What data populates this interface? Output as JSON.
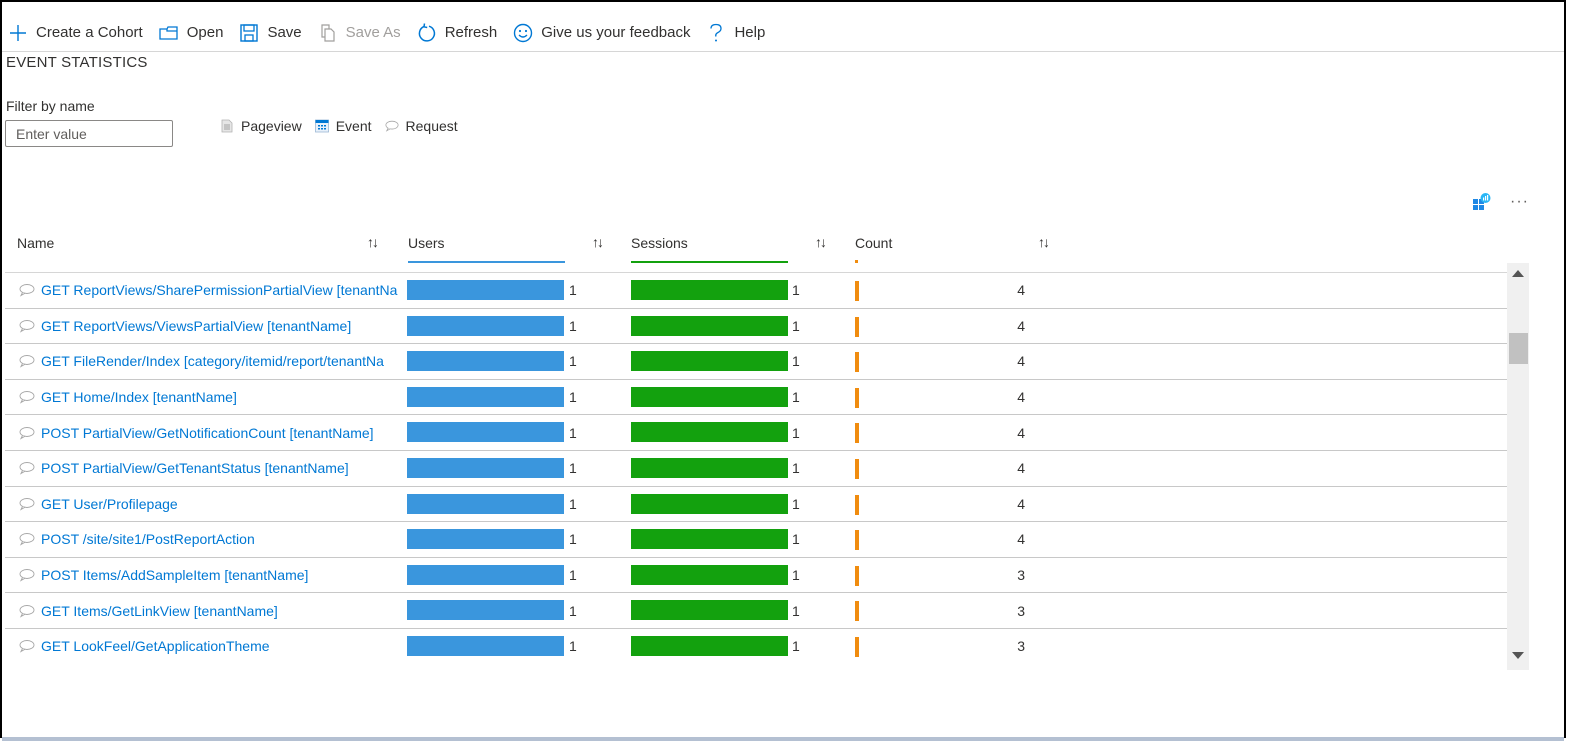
{
  "toolbar": {
    "items": [
      {
        "label": "Create a Cohort",
        "icon": "plus-icon",
        "disabled": false
      },
      {
        "label": "Open",
        "icon": "folder-open-icon",
        "disabled": false
      },
      {
        "label": "Save",
        "icon": "save-icon",
        "disabled": false
      },
      {
        "label": "Save As",
        "icon": "copy-icon",
        "disabled": true
      },
      {
        "label": "Refresh",
        "icon": "refresh-icon",
        "disabled": false
      },
      {
        "label": "Give us your feedback",
        "icon": "smiley-icon",
        "disabled": false
      },
      {
        "label": "Help",
        "icon": "question-icon",
        "disabled": false
      }
    ]
  },
  "section": {
    "title": "EVENT STATISTICS"
  },
  "filter": {
    "label": "Filter by name",
    "placeholder": "Enter value",
    "value": ""
  },
  "legend": [
    {
      "label": "Pageview",
      "icon": "pageview-icon"
    },
    {
      "label": "Event",
      "icon": "event-icon"
    },
    {
      "label": "Request",
      "icon": "request-icon"
    }
  ],
  "actions": {
    "more": "···"
  },
  "colors": {
    "users_bar": "#3a96dd",
    "sessions_bar": "#13a10e",
    "count_mark": "#f08c0f",
    "link": "#0078d4"
  },
  "table": {
    "columns": [
      {
        "label": "Name",
        "sort": "↑↓"
      },
      {
        "label": "Users",
        "sort": "↑↓"
      },
      {
        "label": "Sessions",
        "sort": "↑↓"
      },
      {
        "label": "Count",
        "sort": "↑↓"
      }
    ],
    "rows": [
      {
        "name": "GET ReportViews/SharePermissionPartialView [tenantNa",
        "users": "1",
        "sessions": "1",
        "count": "4",
        "users_frac": 1,
        "sessions_frac": 1
      },
      {
        "name": "GET ReportViews/ViewsPartialView [tenantName]",
        "users": "1",
        "sessions": "1",
        "count": "4",
        "users_frac": 1,
        "sessions_frac": 1
      },
      {
        "name": "GET FileRender/Index [category/itemid/report/tenantNa",
        "users": "1",
        "sessions": "1",
        "count": "4",
        "users_frac": 1,
        "sessions_frac": 1
      },
      {
        "name": "GET Home/Index [tenantName]",
        "users": "1",
        "sessions": "1",
        "count": "4",
        "users_frac": 1,
        "sessions_frac": 1
      },
      {
        "name": "POST PartialView/GetNotificationCount [tenantName]",
        "users": "1",
        "sessions": "1",
        "count": "4",
        "users_frac": 1,
        "sessions_frac": 1
      },
      {
        "name": "POST PartialView/GetTenantStatus [tenantName]",
        "users": "1",
        "sessions": "1",
        "count": "4",
        "users_frac": 1,
        "sessions_frac": 1
      },
      {
        "name": "GET User/Profilepage",
        "users": "1",
        "sessions": "1",
        "count": "4",
        "users_frac": 1,
        "sessions_frac": 1
      },
      {
        "name": "POST /site/site1/PostReportAction",
        "users": "1",
        "sessions": "1",
        "count": "4",
        "users_frac": 1,
        "sessions_frac": 1
      },
      {
        "name": "POST Items/AddSampleItem [tenantName]",
        "users": "1",
        "sessions": "1",
        "count": "3",
        "users_frac": 1,
        "sessions_frac": 1
      },
      {
        "name": "GET Items/GetLinkView [tenantName]",
        "users": "1",
        "sessions": "1",
        "count": "3",
        "users_frac": 1,
        "sessions_frac": 1
      },
      {
        "name": "GET LookFeel/GetApplicationTheme",
        "users": "1",
        "sessions": "1",
        "count": "3",
        "users_frac": 1,
        "sessions_frac": 1
      }
    ]
  }
}
